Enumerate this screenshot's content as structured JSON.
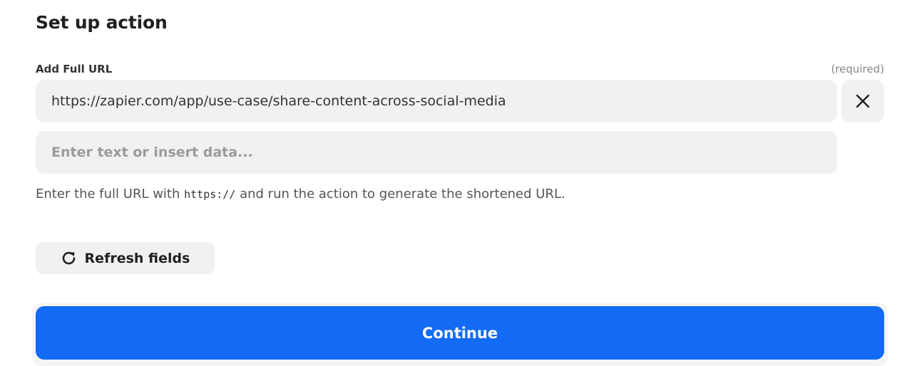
{
  "section": {
    "title": "Set up action"
  },
  "field": {
    "label": "Add Full URL",
    "required_text": "(required)",
    "value": "https://zapier.com/app/use-case/share-content-across-social-media",
    "placeholder": "Enter text or insert data...",
    "help_before": "Enter the full URL with ",
    "help_code": "https://",
    "help_after": " and run the action to generate the shortened URL."
  },
  "actions": {
    "refresh_label": "Refresh fields",
    "continue_label": "Continue"
  },
  "colors": {
    "primary": "#136bf5",
    "input_bg": "#f1f1f1"
  },
  "icons": {
    "clear": "close-icon",
    "refresh": "refresh-icon"
  }
}
